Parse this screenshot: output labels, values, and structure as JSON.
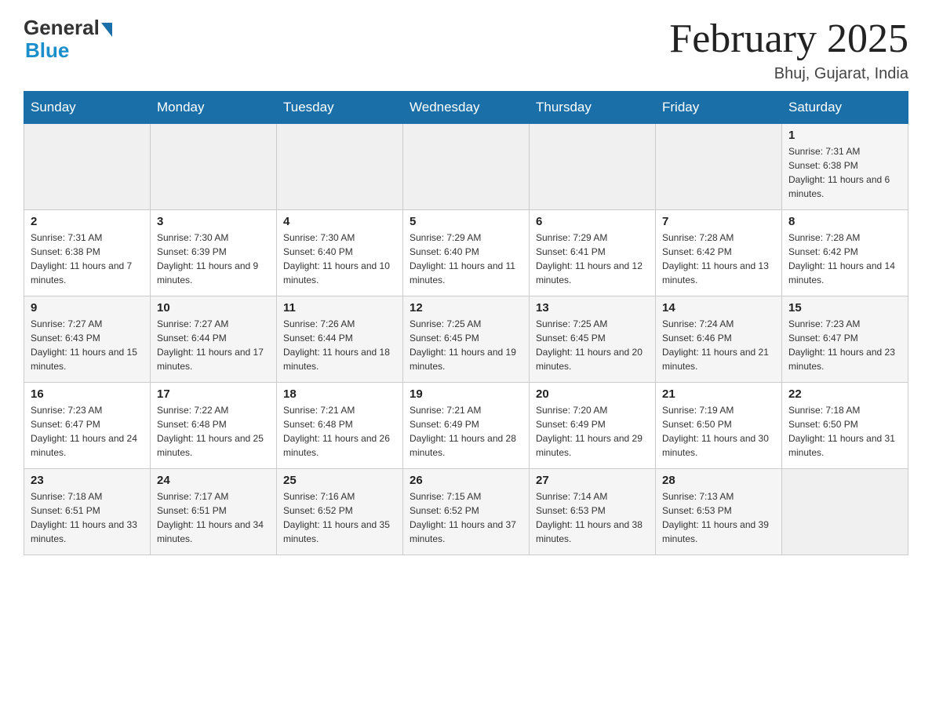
{
  "header": {
    "logo_general": "General",
    "logo_blue": "Blue",
    "month_title": "February 2025",
    "subtitle": "Bhuj, Gujarat, India"
  },
  "days_of_week": [
    "Sunday",
    "Monday",
    "Tuesday",
    "Wednesday",
    "Thursday",
    "Friday",
    "Saturday"
  ],
  "weeks": [
    [
      {
        "day": "",
        "sunrise": "",
        "sunset": "",
        "daylight": ""
      },
      {
        "day": "",
        "sunrise": "",
        "sunset": "",
        "daylight": ""
      },
      {
        "day": "",
        "sunrise": "",
        "sunset": "",
        "daylight": ""
      },
      {
        "day": "",
        "sunrise": "",
        "sunset": "",
        "daylight": ""
      },
      {
        "day": "",
        "sunrise": "",
        "sunset": "",
        "daylight": ""
      },
      {
        "day": "",
        "sunrise": "",
        "sunset": "",
        "daylight": ""
      },
      {
        "day": "1",
        "sunrise": "Sunrise: 7:31 AM",
        "sunset": "Sunset: 6:38 PM",
        "daylight": "Daylight: 11 hours and 6 minutes."
      }
    ],
    [
      {
        "day": "2",
        "sunrise": "Sunrise: 7:31 AM",
        "sunset": "Sunset: 6:38 PM",
        "daylight": "Daylight: 11 hours and 7 minutes."
      },
      {
        "day": "3",
        "sunrise": "Sunrise: 7:30 AM",
        "sunset": "Sunset: 6:39 PM",
        "daylight": "Daylight: 11 hours and 9 minutes."
      },
      {
        "day": "4",
        "sunrise": "Sunrise: 7:30 AM",
        "sunset": "Sunset: 6:40 PM",
        "daylight": "Daylight: 11 hours and 10 minutes."
      },
      {
        "day": "5",
        "sunrise": "Sunrise: 7:29 AM",
        "sunset": "Sunset: 6:40 PM",
        "daylight": "Daylight: 11 hours and 11 minutes."
      },
      {
        "day": "6",
        "sunrise": "Sunrise: 7:29 AM",
        "sunset": "Sunset: 6:41 PM",
        "daylight": "Daylight: 11 hours and 12 minutes."
      },
      {
        "day": "7",
        "sunrise": "Sunrise: 7:28 AM",
        "sunset": "Sunset: 6:42 PM",
        "daylight": "Daylight: 11 hours and 13 minutes."
      },
      {
        "day": "8",
        "sunrise": "Sunrise: 7:28 AM",
        "sunset": "Sunset: 6:42 PM",
        "daylight": "Daylight: 11 hours and 14 minutes."
      }
    ],
    [
      {
        "day": "9",
        "sunrise": "Sunrise: 7:27 AM",
        "sunset": "Sunset: 6:43 PM",
        "daylight": "Daylight: 11 hours and 15 minutes."
      },
      {
        "day": "10",
        "sunrise": "Sunrise: 7:27 AM",
        "sunset": "Sunset: 6:44 PM",
        "daylight": "Daylight: 11 hours and 17 minutes."
      },
      {
        "day": "11",
        "sunrise": "Sunrise: 7:26 AM",
        "sunset": "Sunset: 6:44 PM",
        "daylight": "Daylight: 11 hours and 18 minutes."
      },
      {
        "day": "12",
        "sunrise": "Sunrise: 7:25 AM",
        "sunset": "Sunset: 6:45 PM",
        "daylight": "Daylight: 11 hours and 19 minutes."
      },
      {
        "day": "13",
        "sunrise": "Sunrise: 7:25 AM",
        "sunset": "Sunset: 6:45 PM",
        "daylight": "Daylight: 11 hours and 20 minutes."
      },
      {
        "day": "14",
        "sunrise": "Sunrise: 7:24 AM",
        "sunset": "Sunset: 6:46 PM",
        "daylight": "Daylight: 11 hours and 21 minutes."
      },
      {
        "day": "15",
        "sunrise": "Sunrise: 7:23 AM",
        "sunset": "Sunset: 6:47 PM",
        "daylight": "Daylight: 11 hours and 23 minutes."
      }
    ],
    [
      {
        "day": "16",
        "sunrise": "Sunrise: 7:23 AM",
        "sunset": "Sunset: 6:47 PM",
        "daylight": "Daylight: 11 hours and 24 minutes."
      },
      {
        "day": "17",
        "sunrise": "Sunrise: 7:22 AM",
        "sunset": "Sunset: 6:48 PM",
        "daylight": "Daylight: 11 hours and 25 minutes."
      },
      {
        "day": "18",
        "sunrise": "Sunrise: 7:21 AM",
        "sunset": "Sunset: 6:48 PM",
        "daylight": "Daylight: 11 hours and 26 minutes."
      },
      {
        "day": "19",
        "sunrise": "Sunrise: 7:21 AM",
        "sunset": "Sunset: 6:49 PM",
        "daylight": "Daylight: 11 hours and 28 minutes."
      },
      {
        "day": "20",
        "sunrise": "Sunrise: 7:20 AM",
        "sunset": "Sunset: 6:49 PM",
        "daylight": "Daylight: 11 hours and 29 minutes."
      },
      {
        "day": "21",
        "sunrise": "Sunrise: 7:19 AM",
        "sunset": "Sunset: 6:50 PM",
        "daylight": "Daylight: 11 hours and 30 minutes."
      },
      {
        "day": "22",
        "sunrise": "Sunrise: 7:18 AM",
        "sunset": "Sunset: 6:50 PM",
        "daylight": "Daylight: 11 hours and 31 minutes."
      }
    ],
    [
      {
        "day": "23",
        "sunrise": "Sunrise: 7:18 AM",
        "sunset": "Sunset: 6:51 PM",
        "daylight": "Daylight: 11 hours and 33 minutes."
      },
      {
        "day": "24",
        "sunrise": "Sunrise: 7:17 AM",
        "sunset": "Sunset: 6:51 PM",
        "daylight": "Daylight: 11 hours and 34 minutes."
      },
      {
        "day": "25",
        "sunrise": "Sunrise: 7:16 AM",
        "sunset": "Sunset: 6:52 PM",
        "daylight": "Daylight: 11 hours and 35 minutes."
      },
      {
        "day": "26",
        "sunrise": "Sunrise: 7:15 AM",
        "sunset": "Sunset: 6:52 PM",
        "daylight": "Daylight: 11 hours and 37 minutes."
      },
      {
        "day": "27",
        "sunrise": "Sunrise: 7:14 AM",
        "sunset": "Sunset: 6:53 PM",
        "daylight": "Daylight: 11 hours and 38 minutes."
      },
      {
        "day": "28",
        "sunrise": "Sunrise: 7:13 AM",
        "sunset": "Sunset: 6:53 PM",
        "daylight": "Daylight: 11 hours and 39 minutes."
      },
      {
        "day": "",
        "sunrise": "",
        "sunset": "",
        "daylight": ""
      }
    ]
  ]
}
